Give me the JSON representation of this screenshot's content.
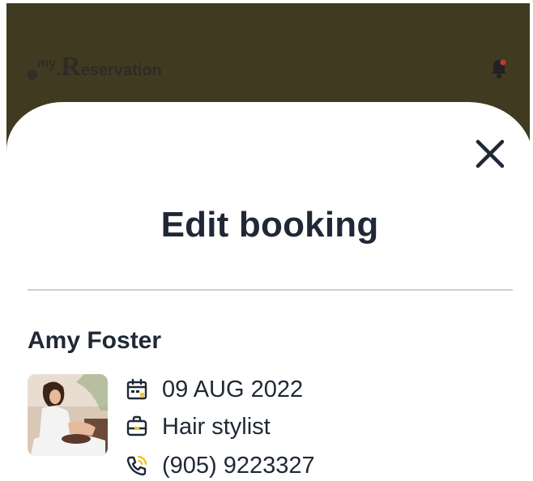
{
  "header": {
    "logo": {
      "prefix": "my",
      "dot": ".",
      "initial": "R",
      "rest": "eservation"
    },
    "colors": {
      "background": "#403a20",
      "bell_badge": "#c0392b"
    }
  },
  "dialog": {
    "title": "Edit booking",
    "close_icon": "close-icon"
  },
  "booking": {
    "customer_name": "Amy Foster",
    "date": "09 AUG 2022",
    "service": "Hair stylist",
    "phone": "(905) 9223327",
    "icons": {
      "date": "calendar-icon",
      "service": "briefcase-icon",
      "phone": "phone-icon"
    },
    "colors": {
      "icon_accent": "#f2c12e",
      "text": "#1f2836"
    }
  }
}
